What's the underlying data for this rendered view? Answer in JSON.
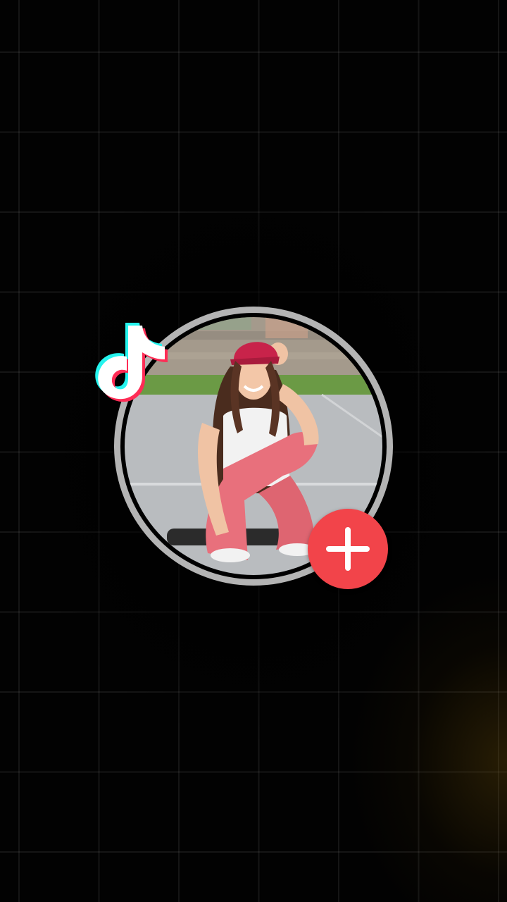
{
  "screen": {
    "background_color": "#020202",
    "grid_line_color": "rgba(255,255,255,0.075)",
    "glow_color": "rgba(110,80,10,0.35)"
  },
  "logo": {
    "icon": "tiktok-logo-icon",
    "colors": {
      "cyan": "#25f4ee",
      "red": "#fe2c55",
      "white": "#ffffff"
    }
  },
  "avatar": {
    "icon": "profile-photo",
    "ring_color": "#b4b4b4",
    "description_colors": {
      "cap": "#c8234a",
      "pants": "#e8707c",
      "shirt": "#f2f2f2",
      "grass": "#6b9a45",
      "pavement": "#b9bcbf"
    }
  },
  "add_button": {
    "icon": "plus-icon",
    "color": "#f2444a"
  }
}
